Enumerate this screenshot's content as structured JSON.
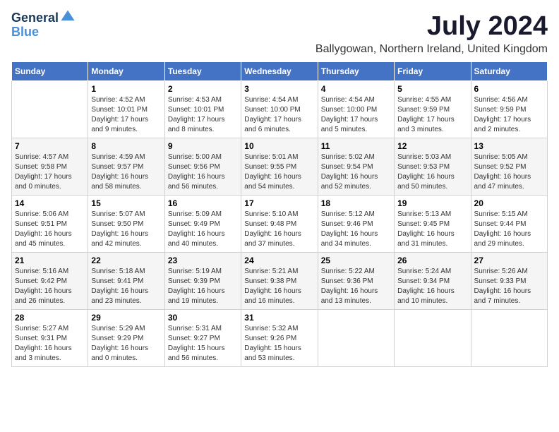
{
  "logo": {
    "line1": "General",
    "line2": "Blue"
  },
  "title": "July 2024",
  "location": "Ballygowan, Northern Ireland, United Kingdom",
  "weekdays": [
    "Sunday",
    "Monday",
    "Tuesday",
    "Wednesday",
    "Thursday",
    "Friday",
    "Saturday"
  ],
  "weeks": [
    [
      {
        "day": "",
        "info": ""
      },
      {
        "day": "1",
        "info": "Sunrise: 4:52 AM\nSunset: 10:01 PM\nDaylight: 17 hours\nand 9 minutes."
      },
      {
        "day": "2",
        "info": "Sunrise: 4:53 AM\nSunset: 10:01 PM\nDaylight: 17 hours\nand 8 minutes."
      },
      {
        "day": "3",
        "info": "Sunrise: 4:54 AM\nSunset: 10:00 PM\nDaylight: 17 hours\nand 6 minutes."
      },
      {
        "day": "4",
        "info": "Sunrise: 4:54 AM\nSunset: 10:00 PM\nDaylight: 17 hours\nand 5 minutes."
      },
      {
        "day": "5",
        "info": "Sunrise: 4:55 AM\nSunset: 9:59 PM\nDaylight: 17 hours\nand 3 minutes."
      },
      {
        "day": "6",
        "info": "Sunrise: 4:56 AM\nSunset: 9:59 PM\nDaylight: 17 hours\nand 2 minutes."
      }
    ],
    [
      {
        "day": "7",
        "info": "Sunrise: 4:57 AM\nSunset: 9:58 PM\nDaylight: 17 hours\nand 0 minutes."
      },
      {
        "day": "8",
        "info": "Sunrise: 4:59 AM\nSunset: 9:57 PM\nDaylight: 16 hours\nand 58 minutes."
      },
      {
        "day": "9",
        "info": "Sunrise: 5:00 AM\nSunset: 9:56 PM\nDaylight: 16 hours\nand 56 minutes."
      },
      {
        "day": "10",
        "info": "Sunrise: 5:01 AM\nSunset: 9:55 PM\nDaylight: 16 hours\nand 54 minutes."
      },
      {
        "day": "11",
        "info": "Sunrise: 5:02 AM\nSunset: 9:54 PM\nDaylight: 16 hours\nand 52 minutes."
      },
      {
        "day": "12",
        "info": "Sunrise: 5:03 AM\nSunset: 9:53 PM\nDaylight: 16 hours\nand 50 minutes."
      },
      {
        "day": "13",
        "info": "Sunrise: 5:05 AM\nSunset: 9:52 PM\nDaylight: 16 hours\nand 47 minutes."
      }
    ],
    [
      {
        "day": "14",
        "info": "Sunrise: 5:06 AM\nSunset: 9:51 PM\nDaylight: 16 hours\nand 45 minutes."
      },
      {
        "day": "15",
        "info": "Sunrise: 5:07 AM\nSunset: 9:50 PM\nDaylight: 16 hours\nand 42 minutes."
      },
      {
        "day": "16",
        "info": "Sunrise: 5:09 AM\nSunset: 9:49 PM\nDaylight: 16 hours\nand 40 minutes."
      },
      {
        "day": "17",
        "info": "Sunrise: 5:10 AM\nSunset: 9:48 PM\nDaylight: 16 hours\nand 37 minutes."
      },
      {
        "day": "18",
        "info": "Sunrise: 5:12 AM\nSunset: 9:46 PM\nDaylight: 16 hours\nand 34 minutes."
      },
      {
        "day": "19",
        "info": "Sunrise: 5:13 AM\nSunset: 9:45 PM\nDaylight: 16 hours\nand 31 minutes."
      },
      {
        "day": "20",
        "info": "Sunrise: 5:15 AM\nSunset: 9:44 PM\nDaylight: 16 hours\nand 29 minutes."
      }
    ],
    [
      {
        "day": "21",
        "info": "Sunrise: 5:16 AM\nSunset: 9:42 PM\nDaylight: 16 hours\nand 26 minutes."
      },
      {
        "day": "22",
        "info": "Sunrise: 5:18 AM\nSunset: 9:41 PM\nDaylight: 16 hours\nand 23 minutes."
      },
      {
        "day": "23",
        "info": "Sunrise: 5:19 AM\nSunset: 9:39 PM\nDaylight: 16 hours\nand 19 minutes."
      },
      {
        "day": "24",
        "info": "Sunrise: 5:21 AM\nSunset: 9:38 PM\nDaylight: 16 hours\nand 16 minutes."
      },
      {
        "day": "25",
        "info": "Sunrise: 5:22 AM\nSunset: 9:36 PM\nDaylight: 16 hours\nand 13 minutes."
      },
      {
        "day": "26",
        "info": "Sunrise: 5:24 AM\nSunset: 9:34 PM\nDaylight: 16 hours\nand 10 minutes."
      },
      {
        "day": "27",
        "info": "Sunrise: 5:26 AM\nSunset: 9:33 PM\nDaylight: 16 hours\nand 7 minutes."
      }
    ],
    [
      {
        "day": "28",
        "info": "Sunrise: 5:27 AM\nSunset: 9:31 PM\nDaylight: 16 hours\nand 3 minutes."
      },
      {
        "day": "29",
        "info": "Sunrise: 5:29 AM\nSunset: 9:29 PM\nDaylight: 16 hours\nand 0 minutes."
      },
      {
        "day": "30",
        "info": "Sunrise: 5:31 AM\nSunset: 9:27 PM\nDaylight: 15 hours\nand 56 minutes."
      },
      {
        "day": "31",
        "info": "Sunrise: 5:32 AM\nSunset: 9:26 PM\nDaylight: 15 hours\nand 53 minutes."
      },
      {
        "day": "",
        "info": ""
      },
      {
        "day": "",
        "info": ""
      },
      {
        "day": "",
        "info": ""
      }
    ]
  ]
}
